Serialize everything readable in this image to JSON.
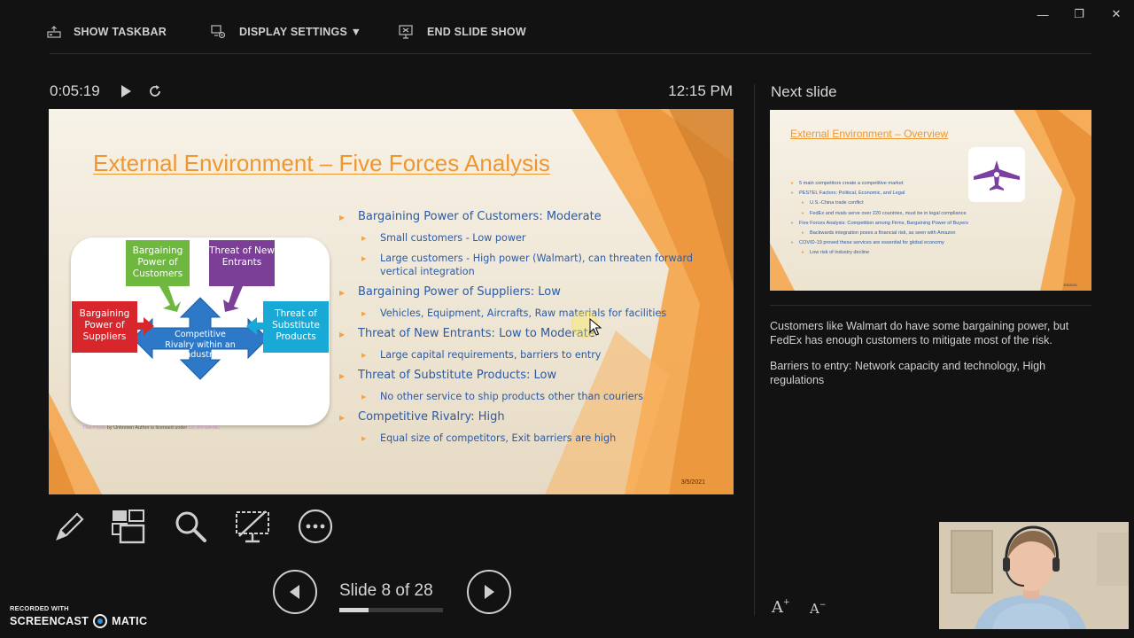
{
  "toolbar": {
    "show_taskbar": "SHOW TASKBAR",
    "display_settings": "DISPLAY SETTINGS ▼",
    "end_slide_show": "END SLIDE SHOW"
  },
  "window_controls": {
    "minimize": "—",
    "restore": "❐",
    "close": "✕"
  },
  "presenter": {
    "timer": "0:05:19",
    "clock": "12:15 PM"
  },
  "slide": {
    "title": "External Environment – Five Forces Analysis",
    "diagram": {
      "center": "Competitive Rivalry within an Industry",
      "top_left": "Bargaining Power of Customers",
      "top_right": "Threat of New Entrants",
      "left": "Bargaining Power of Suppliers",
      "right": "Threat of Substitute Products",
      "credit_link": "This Photo",
      "credit_text": " by Unknown Author is licensed under ",
      "credit_license": "CC BY-SA-NC"
    },
    "bullets": [
      {
        "text": "Bargaining Power of Customers: Moderate",
        "subs": [
          "Small customers - Low power",
          "Large customers - High power (Walmart), can threaten forward vertical integration"
        ]
      },
      {
        "text": "Bargaining Power of Suppliers: Low",
        "subs": [
          "Vehicles, Equipment, Aircrafts, Raw materials for facilities"
        ]
      },
      {
        "text": "Threat of New Entrants: Low to Moderate",
        "subs": [
          "Large capital requirements, barriers to entry"
        ]
      },
      {
        "text": " Threat of Substitute Products: Low",
        "subs": [
          "No other service to ship products other than couriers"
        ]
      },
      {
        "text": "Competitive Rivalry: High",
        "subs": [
          "Equal size of competitors, Exit barriers are high"
        ]
      }
    ],
    "date": "3/5/2021"
  },
  "navigation": {
    "counter": "Slide 8 of 28",
    "current": 8,
    "total": 28
  },
  "next_slide": {
    "label": "Next slide",
    "title": "External Environment – Overview",
    "bullets": [
      {
        "level": 1,
        "text": "5 main competitors create a competitive market"
      },
      {
        "level": 1,
        "text": "PESTEL Factors: Political, Economic, and Legal"
      },
      {
        "level": 2,
        "text": "U.S.-China trade conflict"
      },
      {
        "level": 2,
        "text": "FedEx and rivals serve over 220 countries, must be in legal compliance"
      },
      {
        "level": 1,
        "text": "Five Forces Analysis: Competition among Firms, Bargaining Power of Buyers"
      },
      {
        "level": 2,
        "text": "Backwards integration poses a financial risk, as seen with Amazon"
      },
      {
        "level": 1,
        "text": "COVID-19 proved these services are essential for global economy"
      },
      {
        "level": 2,
        "text": "Low risk of industry decline"
      }
    ],
    "date": "3/5/2021"
  },
  "notes": {
    "p1": "Customers like Walmart do have some bargaining power, but FedEx has enough customers to mitigate most of the risk.",
    "p2": "Barriers to entry: Network capacity and technology, High regulations"
  },
  "font_controls": {
    "increase": "A",
    "decrease": "A"
  },
  "watermark": {
    "line1": "RECORDED WITH",
    "brand_left": "SCREENCAST",
    "brand_right": "MATIC"
  },
  "colors": {
    "title_orange": "#f0962e",
    "bullet_blue": "#2b5aa5",
    "accent_orange": "#f4a24b",
    "green": "#6fb83f",
    "purple": "#7c3f98",
    "red": "#d8262d",
    "teal": "#19a9d6",
    "blue": "#2e78c8"
  }
}
